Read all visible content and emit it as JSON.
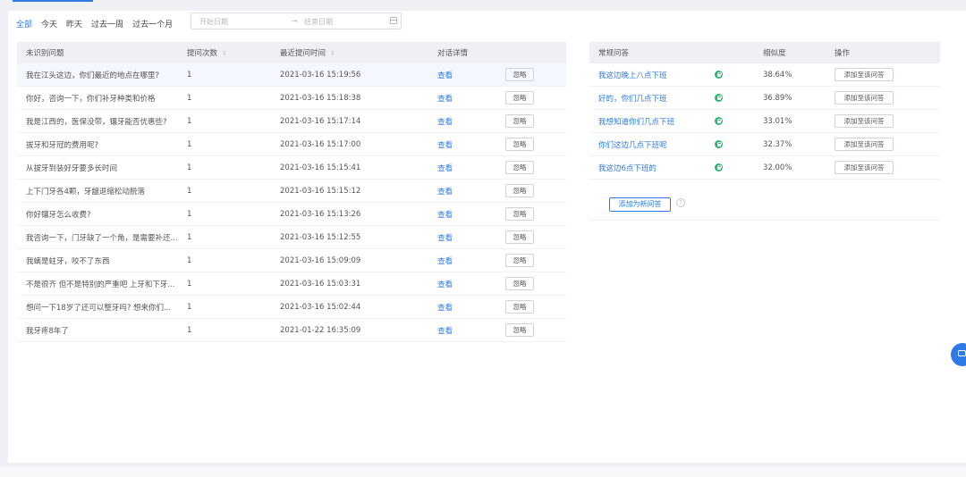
{
  "filters": {
    "items": [
      "全部",
      "今天",
      "昨天",
      "过去一周",
      "过去一个月"
    ],
    "active_index": 0
  },
  "date_range": {
    "start_placeholder": "开始日期",
    "separator": "→",
    "end_placeholder": "结束日期"
  },
  "left_table": {
    "headers": {
      "question": "未识别问题",
      "count": "提问次数",
      "last_time": "最近提问时间",
      "detail": "对话详情",
      "sort_icon": "⇕"
    },
    "view_label": "查看",
    "ignore_label": "忽略",
    "rows": [
      {
        "question": "我在江头这边，你们最近的地点在哪里?",
        "count": "1",
        "time": "2021-03-16 15:19:56"
      },
      {
        "question": "你好，咨询一下，你们补牙种类和价格",
        "count": "1",
        "time": "2021-03-16 15:18:38"
      },
      {
        "question": "我是江西的，医保没带，镶牙能否优惠些?",
        "count": "1",
        "time": "2021-03-16 15:17:14"
      },
      {
        "question": "拔牙和牙冠的费用呢?",
        "count": "1",
        "time": "2021-03-16 15:17:00"
      },
      {
        "question": "从拔牙到装好牙要多长时间",
        "count": "1",
        "time": "2021-03-16 15:15:41"
      },
      {
        "question": "上下门牙各4颗，牙龈退缩松动脱落",
        "count": "1",
        "time": "2021-03-16 15:15:12"
      },
      {
        "question": "你好镶牙怎么收费?",
        "count": "1",
        "time": "2021-03-16 15:13:26"
      },
      {
        "question": "我咨询一下，门牙缺了一个角，是需要补还...",
        "count": "1",
        "time": "2021-03-16 15:12:55"
      },
      {
        "question": "我螨是蛀牙，咬不了东西",
        "count": "1",
        "time": "2021-03-16 15:09:09"
      },
      {
        "question": "不是很齐 但不是特别的严重吧 上牙和下牙...",
        "count": "1",
        "time": "2021-03-16 15:03:31"
      },
      {
        "question": "想问一下18岁了还可以整牙吗? 想来你们...",
        "count": "1",
        "time": "2021-03-16 15:02:44"
      },
      {
        "question": "我牙疼8年了",
        "count": "1",
        "time": "2021-01-22 16:35:09"
      }
    ]
  },
  "right_table": {
    "headers": {
      "qa": "常规问答",
      "similarity": "相似度",
      "action": "操作"
    },
    "add_label": "添加至该问答",
    "rows": [
      {
        "qa": "我这边晚上八点下班",
        "similarity": "38.64%"
      },
      {
        "qa": "好的，你们几点下班",
        "similarity": "36.89%"
      },
      {
        "qa": "我想知道你们几点下班",
        "similarity": "33.01%"
      },
      {
        "qa": "你们这边几点下班呢",
        "similarity": "32.37%"
      },
      {
        "qa": "我这边6点下班的",
        "similarity": "32.00%"
      }
    ],
    "new_qa_label": "添加为新问答",
    "help_glyph": "?"
  },
  "icons": {
    "lock": "lock-icon",
    "calendar": "calendar-icon",
    "help": "help-icon",
    "chat": "chat-icon"
  },
  "colors": {
    "accent": "#2f7ae5",
    "lock_green": "#2bb673"
  }
}
